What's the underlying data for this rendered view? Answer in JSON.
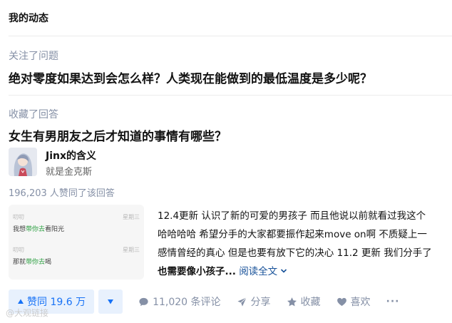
{
  "header": {
    "title": "我的动态"
  },
  "feed": [
    {
      "meta": "关注了问题",
      "title": "绝对零度如果达到会怎么样？人类现在能做到的最低温度是多少呢？"
    },
    {
      "meta": "收藏了回答",
      "title": "女生有男朋友之后才知道的事情有哪些？",
      "author": {
        "name": "Jinx的含义",
        "bio": "就是金克斯"
      },
      "voters": "196,203 人赞同了该回答",
      "thumbnail": {
        "rows": [
          {
            "sender": "叨叨",
            "time": "星期三",
            "msg_pre": "我想",
            "msg_hl": "带你去",
            "msg_post": "看阳光"
          },
          {
            "sender": "叨叨",
            "time": "星期三",
            "msg_pre": "那就",
            "msg_hl": "带你去",
            "msg_post": "喝"
          }
        ]
      },
      "excerpt": {
        "line1": "12.4更新 认识了新的可爱的男孩子 而且他说以前就看过我这个",
        "line2": "哈哈哈哈 希望分手的大家都要振作起来move on啊 不质疑上一",
        "line3": "感情曾经的真心 但是也要有放下它的决心 11.2 更新 我们分手了",
        "line4_bold": "也需要像小孩子...",
        "read_more": "阅读全文"
      },
      "actions": {
        "vote_up": "赞同 19.6 万",
        "comments": "11,020 条评论",
        "share": "分享",
        "collect": "收藏",
        "like": "喜欢",
        "more": "···"
      }
    }
  ],
  "watermark": "@大观链接",
  "colors": {
    "accent": "#1772f6",
    "accent_bg": "#e8f1fd",
    "meta": "#8590a6",
    "link": "#175199"
  }
}
